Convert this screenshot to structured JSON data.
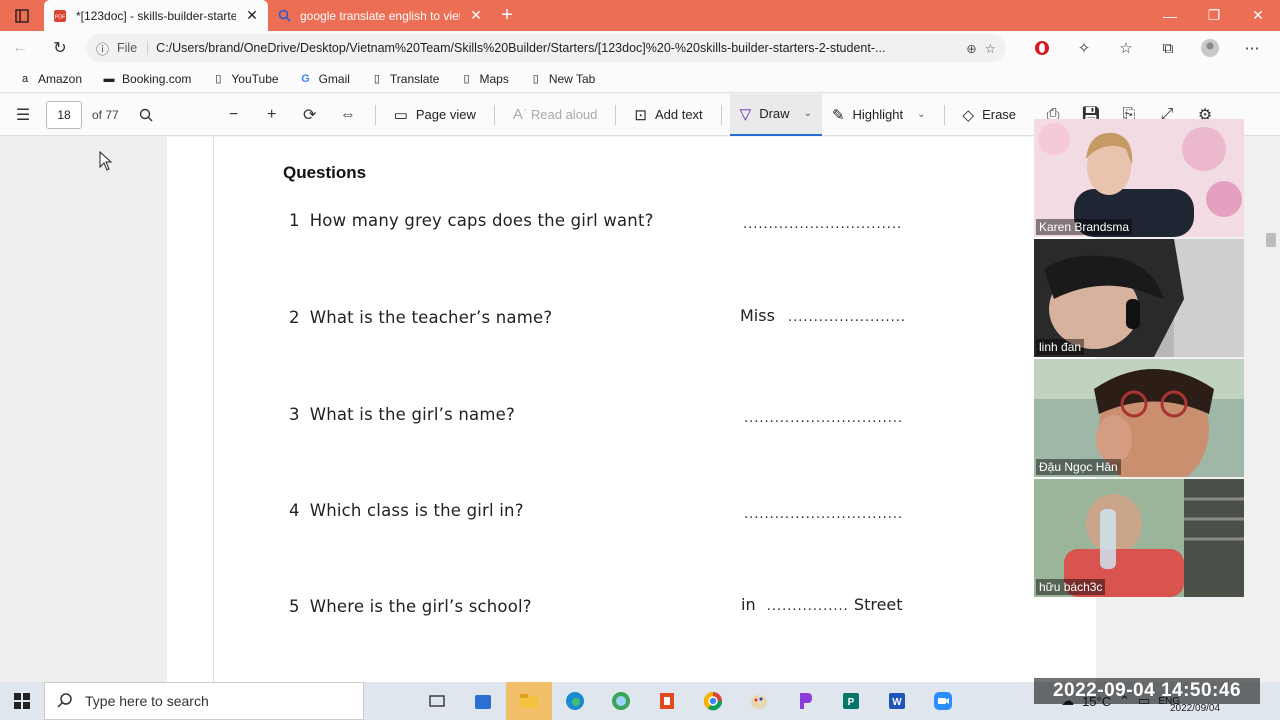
{
  "tabs": [
    {
      "label": "*[123doc] - skills-builder-starters-2",
      "active": true
    },
    {
      "label": "google translate english to vietnam",
      "active": false
    }
  ],
  "address": {
    "file_label": "File",
    "url": "C:/Users/brand/OneDrive/Desktop/Vietnam%20Team/Skills%20Builder/Starters/[123doc]%20-%20skills-builder-starters-2-student-..."
  },
  "bookmarks": [
    "Amazon",
    "Booking.com",
    "YouTube",
    "Gmail",
    "Translate",
    "Maps",
    "New Tab"
  ],
  "pdf_toolbar": {
    "page_number": "18",
    "page_total": "of 77",
    "page_view": "Page view",
    "read_aloud": "Read aloud",
    "add_text": "Add text",
    "draw": "Draw",
    "highlight": "Highlight",
    "erase": "Erase"
  },
  "worksheet": {
    "heading": "Questions",
    "questions": [
      {
        "num": "1",
        "text": "How many grey caps does the girl want?",
        "prefix": "",
        "dots": "...............................",
        "suffix": ""
      },
      {
        "num": "2",
        "text": "What is the teacher’s name?",
        "prefix": "Miss",
        "dots": ".......................",
        "suffix": ""
      },
      {
        "num": "3",
        "text": "What is the girl’s name?",
        "prefix": "",
        "dots": "...............................",
        "suffix": ""
      },
      {
        "num": "4",
        "text": "Which class is the girl in?",
        "prefix": "",
        "dots": "...............................",
        "suffix": ""
      },
      {
        "num": "5",
        "text": "Where is the girl’s school?",
        "prefix": "in",
        "dots": "................",
        "suffix": "Street"
      }
    ]
  },
  "participants": [
    "Karen Brandsma",
    "linh đan",
    "Đậu Ngọc Hân",
    "hữu bách3c"
  ],
  "taskbar": {
    "search_placeholder": "Type here to search",
    "weather": "15°C",
    "lang": "ENG",
    "date": "2022/09/04"
  },
  "overlay_timestamp": "2022-09-04  14:50:46"
}
